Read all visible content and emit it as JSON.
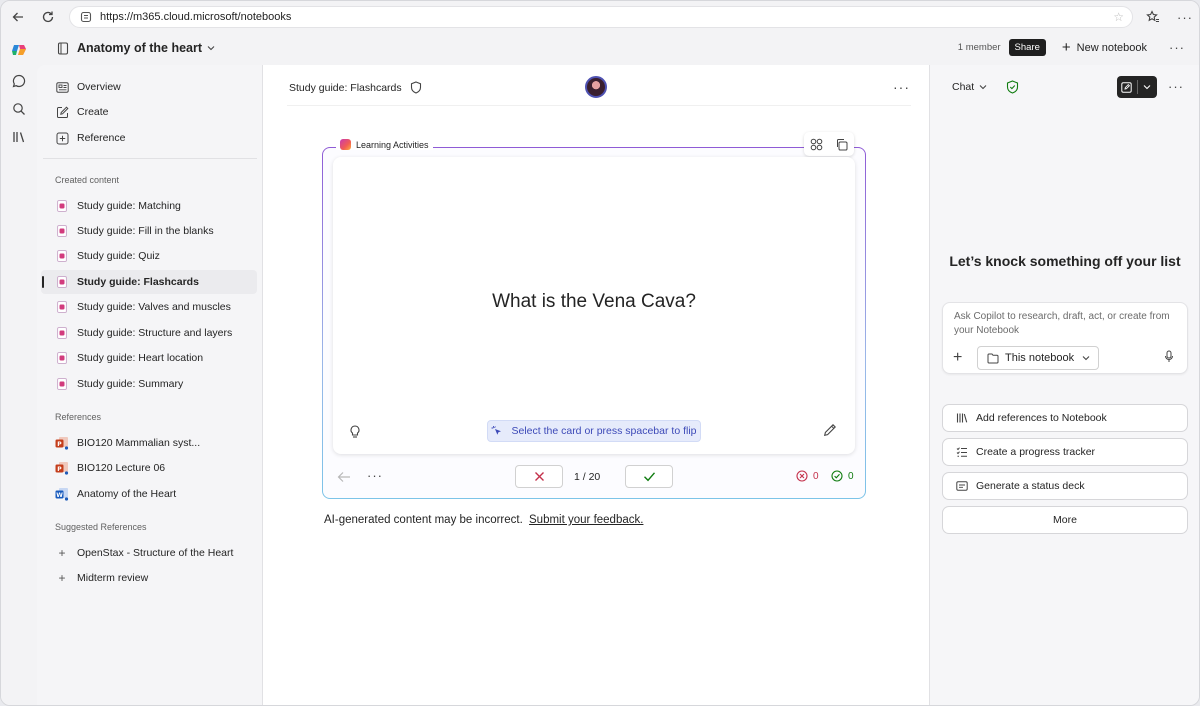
{
  "browser": {
    "url": "https://m365.cloud.microsoft/notebooks"
  },
  "header": {
    "notebook_title": "Anatomy of the heart",
    "members": "1 member",
    "share_label": "Share",
    "new_notebook_label": "New notebook"
  },
  "sidebar": {
    "top_items": [
      {
        "label": "Overview",
        "icon": "overview-icon"
      },
      {
        "label": "Create",
        "icon": "create-icon"
      },
      {
        "label": "Reference",
        "icon": "reference-icon"
      }
    ],
    "created_label": "Created content",
    "created_items": [
      {
        "label": "Study guide: Matching"
      },
      {
        "label": "Study guide: Fill in the blanks"
      },
      {
        "label": "Study guide: Quiz"
      },
      {
        "label": "Study guide: Flashcards",
        "active": true
      },
      {
        "label": "Study guide: Valves and muscles"
      },
      {
        "label": "Study guide: Structure and layers"
      },
      {
        "label": "Study guide: Heart location"
      },
      {
        "label": "Study guide: Summary"
      }
    ],
    "references_label": "References",
    "reference_items": [
      {
        "label": "BIO120 Mammalian syst...",
        "icon": "powerpoint-file-icon"
      },
      {
        "label": "BIO120 Lecture 06",
        "icon": "powerpoint-file-icon"
      },
      {
        "label": "Anatomy of the Heart",
        "icon": "word-file-icon"
      }
    ],
    "suggested_label": "Suggested References",
    "suggested_items": [
      {
        "label": "OpenStax - Structure of the Heart"
      },
      {
        "label": "Midterm review"
      }
    ]
  },
  "main": {
    "page_title": "Study guide: Flashcards",
    "activity_label": "Learning Activities",
    "card_question": "What is the Vena Cava?",
    "flip_hint": "Select the card or press spacebar to flip",
    "counter": "1 / 20",
    "wrong_count": "0",
    "right_count": "0",
    "disclaimer": "AI-generated content may be incorrect.",
    "feedback_link": "Submit your feedback."
  },
  "chat": {
    "header_label": "Chat",
    "heading": "Let’s knock something off your list",
    "placeholder": "Ask Copilot to research, draft, act, or create from your Notebook",
    "scope_label": "This notebook",
    "suggestions": [
      {
        "label": "Add references to Notebook",
        "icon": "library-icon"
      },
      {
        "label": "Create a progress tracker",
        "icon": "checklist-icon"
      },
      {
        "label": "Generate a status deck",
        "icon": "slides-icon"
      },
      {
        "label": "More",
        "icon": ""
      }
    ]
  },
  "colors": {
    "accent": "#4f52b2",
    "wrong": "#c4314b",
    "right": "#107c10",
    "dark_button": "#242424"
  }
}
